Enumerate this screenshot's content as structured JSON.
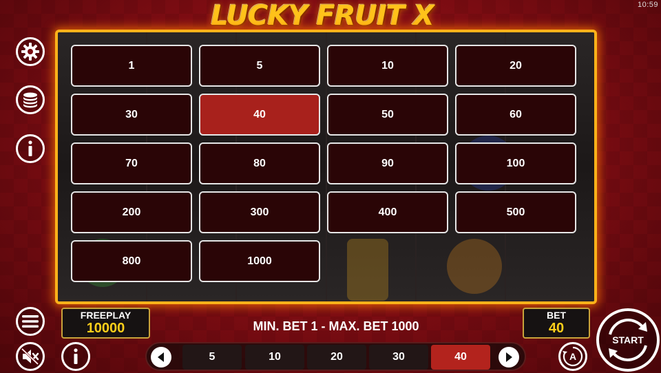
{
  "status": {
    "clock": "10:59"
  },
  "header": {
    "logo_text": "LUCKY FRUIT X"
  },
  "side_buttons": [
    {
      "name": "settings",
      "icon": "gear-icon"
    },
    {
      "name": "coins",
      "icon": "coins-stack-icon"
    },
    {
      "name": "info",
      "icon": "info-icon"
    }
  ],
  "bet_options": [
    {
      "label": "1"
    },
    {
      "label": "5"
    },
    {
      "label": "10"
    },
    {
      "label": "20"
    },
    {
      "label": "30"
    },
    {
      "label": "40",
      "selected": true
    },
    {
      "label": "50"
    },
    {
      "label": "60"
    },
    {
      "label": "70"
    },
    {
      "label": "80"
    },
    {
      "label": "90"
    },
    {
      "label": "100"
    },
    {
      "label": "200"
    },
    {
      "label": "300"
    },
    {
      "label": "400"
    },
    {
      "label": "500"
    },
    {
      "label": "800"
    },
    {
      "label": "1000"
    }
  ],
  "hud": {
    "freeplay_label": "FREEPLAY",
    "freeplay_value": "10000",
    "min_max_text": "MIN. BET 1 - MAX. BET 1000",
    "bet_label": "BET",
    "bet_value": "40",
    "start_label": "START",
    "auto_label": "A"
  },
  "quick_bets": [
    {
      "label": "5"
    },
    {
      "label": "10"
    },
    {
      "label": "20"
    },
    {
      "label": "30"
    },
    {
      "label": "40",
      "selected": true
    }
  ],
  "colors": {
    "selected": "#a8211c",
    "gold": "#ffcf1a",
    "frame": "#ffb21a",
    "background": "#7a0c12"
  }
}
